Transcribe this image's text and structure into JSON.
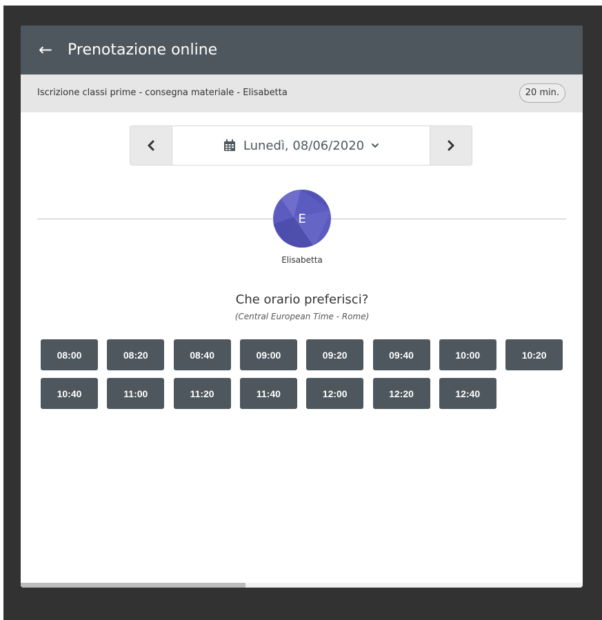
{
  "header": {
    "back_icon": "arrow-left-icon",
    "back_glyph": "←",
    "title": "Prenotazione online"
  },
  "service": {
    "name": "Iscrizione classi prime - consegna materiale - Elisabetta",
    "duration": "20 min."
  },
  "date_nav": {
    "prev_icon": "chevron-left-icon",
    "prev_glyph": "‹",
    "next_icon": "chevron-right-icon",
    "next_glyph": "›",
    "calendar_icon": "calendar-icon",
    "date": "Lunedì, 08/06/2020",
    "dropdown_icon": "chevron-down-icon"
  },
  "staff": {
    "initial": "E",
    "name": "Elisabetta",
    "avatar_color": "#5c5cc0"
  },
  "times": {
    "question": "Che orario preferisci?",
    "timezone": "(Central European Time - Rome)",
    "slots": [
      "08:00",
      "08:20",
      "08:40",
      "09:00",
      "09:20",
      "09:40",
      "10:00",
      "10:20",
      "10:40",
      "11:00",
      "11:20",
      "11:40",
      "12:00",
      "12:20",
      "12:40"
    ]
  },
  "colors": {
    "header_bg": "#4d575d",
    "subheader_bg": "#e6e6e6",
    "slot_bg": "#4d575d",
    "page_bg": "#323232"
  }
}
